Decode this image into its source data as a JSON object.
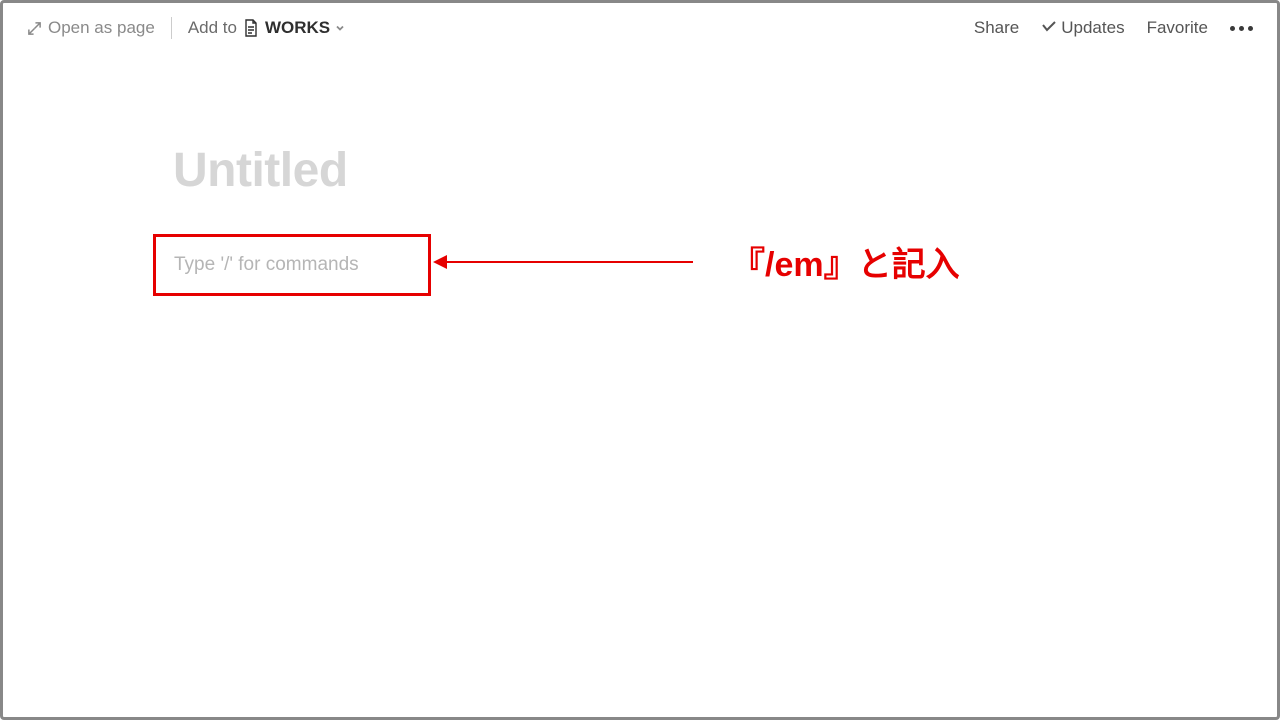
{
  "topbar": {
    "open_as_page": "Open as page",
    "add_to": "Add to",
    "breadcrumb": "WORKS",
    "share": "Share",
    "updates": "Updates",
    "favorite": "Favorite"
  },
  "page": {
    "title_placeholder": "Untitled",
    "command_placeholder": "Type '/' for commands"
  },
  "annotation": {
    "text": "『/em』と記入"
  },
  "colors": {
    "accent": "#e60000"
  }
}
